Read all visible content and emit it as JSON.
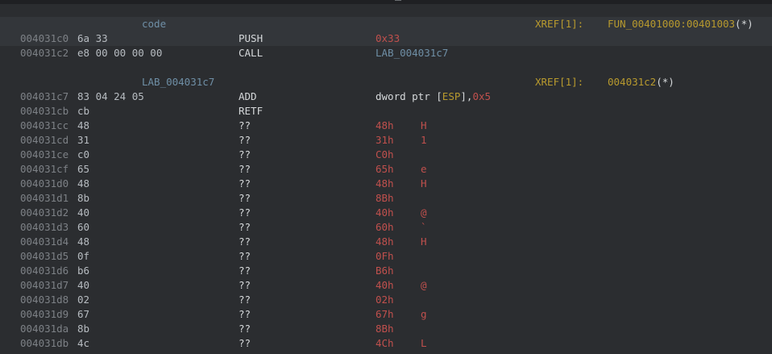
{
  "header_blocks": [
    {
      "label": "code",
      "xref_header": "XREF[1]:",
      "xref_target": "FUN_00401000:00401003",
      "xref_suffix": "(*)"
    },
    {
      "label": "LAB_004031c7",
      "xref_header": "XREF[1]:",
      "xref_target": "004031c2",
      "xref_suffix": "(*)"
    }
  ],
  "instructions": [
    {
      "addr": "004031c0",
      "bytes": "6a 33",
      "mnemonic": "PUSH",
      "operand": "0x33"
    },
    {
      "addr": "004031c2",
      "bytes": "e8 00 00 00 00",
      "mnemonic": "CALL",
      "operand": "LAB_004031c7"
    },
    {
      "addr": "004031c7",
      "bytes": "83 04 24 05",
      "mnemonic": "ADD",
      "operand_a": "dword ptr [",
      "operand_reg": "ESP",
      "operand_b": "],",
      "operand_imm": "0x5"
    },
    {
      "addr": "004031cb",
      "bytes": "cb",
      "mnemonic": "RETF",
      "operand": ""
    }
  ],
  "data_rows": [
    {
      "addr": "004031cc",
      "bytes": "48",
      "mnemonic": "??",
      "value": "48h",
      "ascii": "H"
    },
    {
      "addr": "004031cd",
      "bytes": "31",
      "mnemonic": "??",
      "value": "31h",
      "ascii": "1"
    },
    {
      "addr": "004031ce",
      "bytes": "c0",
      "mnemonic": "??",
      "value": "C0h",
      "ascii": ""
    },
    {
      "addr": "004031cf",
      "bytes": "65",
      "mnemonic": "??",
      "value": "65h",
      "ascii": "e"
    },
    {
      "addr": "004031d0",
      "bytes": "48",
      "mnemonic": "??",
      "value": "48h",
      "ascii": "H"
    },
    {
      "addr": "004031d1",
      "bytes": "8b",
      "mnemonic": "??",
      "value": "8Bh",
      "ascii": ""
    },
    {
      "addr": "004031d2",
      "bytes": "40",
      "mnemonic": "??",
      "value": "40h",
      "ascii": "@"
    },
    {
      "addr": "004031d3",
      "bytes": "60",
      "mnemonic": "??",
      "value": "60h",
      "ascii": "`"
    },
    {
      "addr": "004031d4",
      "bytes": "48",
      "mnemonic": "??",
      "value": "48h",
      "ascii": "H"
    },
    {
      "addr": "004031d5",
      "bytes": "0f",
      "mnemonic": "??",
      "value": "0Fh",
      "ascii": ""
    },
    {
      "addr": "004031d6",
      "bytes": "b6",
      "mnemonic": "??",
      "value": "B6h",
      "ascii": ""
    },
    {
      "addr": "004031d7",
      "bytes": "40",
      "mnemonic": "??",
      "value": "40h",
      "ascii": "@"
    },
    {
      "addr": "004031d8",
      "bytes": "02",
      "mnemonic": "??",
      "value": "02h",
      "ascii": ""
    },
    {
      "addr": "004031d9",
      "bytes": "67",
      "mnemonic": "??",
      "value": "67h",
      "ascii": "g"
    },
    {
      "addr": "004031da",
      "bytes": "8b",
      "mnemonic": "??",
      "value": "8Bh",
      "ascii": ""
    },
    {
      "addr": "004031db",
      "bytes": "4c",
      "mnemonic": "??",
      "value": "4Ch",
      "ascii": "L"
    }
  ],
  "colors": {
    "background": "#2b2d30",
    "selected_band": "#33363a",
    "address": "#7d8186",
    "label": "#6f8fa6",
    "xref": "#b89a2e",
    "scalar": "#c0504d"
  }
}
